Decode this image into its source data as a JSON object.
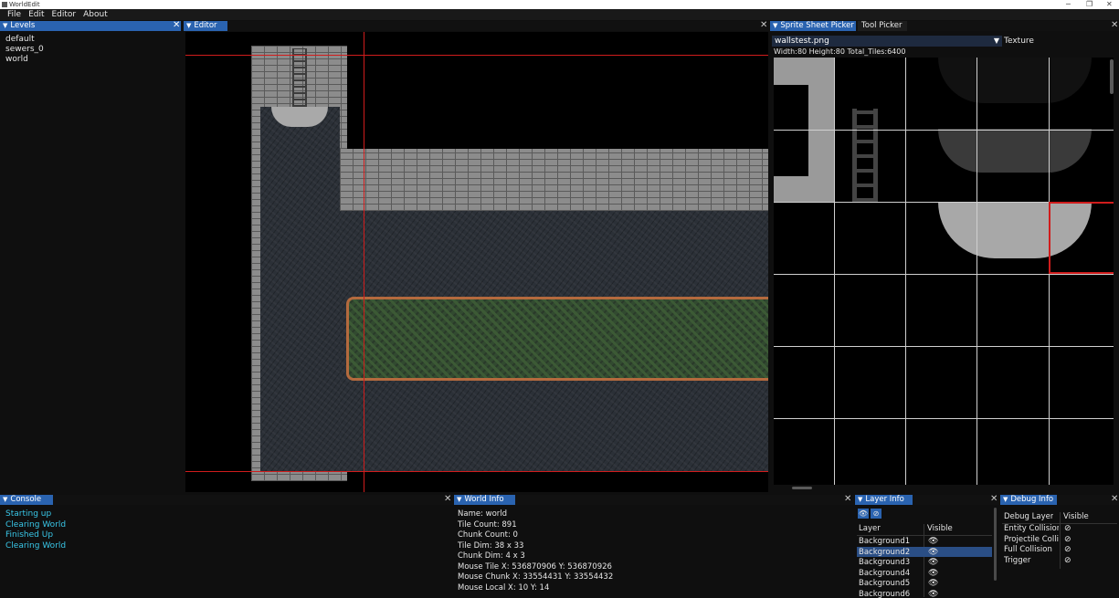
{
  "window": {
    "title": "WorldEdit",
    "minimize": "─",
    "restore": "❐",
    "close": "✕"
  },
  "menu": [
    "File",
    "Edit",
    "Editor",
    "About"
  ],
  "levels": {
    "tab": "Levels",
    "items": [
      "default",
      "sewers_0",
      "world"
    ]
  },
  "editor": {
    "tab": "Editor"
  },
  "sprite_picker": {
    "tab": "Sprite Sheet Picker",
    "tab2": "Tool Picker",
    "texture_value": "wallstest.png",
    "texture_label": "Texture",
    "stats": "Width:80  Height:80  Total_Tiles:6400"
  },
  "console": {
    "tab": "Console",
    "lines": [
      "Starting up",
      "Clearing World",
      "Finished Up",
      "Clearing World"
    ]
  },
  "world_info": {
    "tab": "World Info",
    "lines": [
      "Name:  world",
      "Tile Count: 891",
      "Chunk Count: 0",
      "Tile Dim: 38 x 33",
      "Chunk Dim: 4 x 3",
      "Mouse Tile X: 536870906 Y: 536870926",
      "Mouse Chunk X: 33554431 Y: 33554432",
      "Mouse Local X: 10 Y: 14"
    ]
  },
  "layer_info": {
    "tab": "Layer Info",
    "col_layer": "Layer",
    "col_visible": "Visible",
    "rows": [
      "Background1",
      "Background2",
      "Background3",
      "Background4",
      "Background5",
      "Background6"
    ],
    "selected_index": 1
  },
  "debug_info": {
    "tab": "Debug Info",
    "col_layer": "Debug Layer",
    "col_visible": "Visible",
    "rows": [
      "Entity Collision",
      "Projectile Collisio",
      "Full Collision",
      "Trigger"
    ]
  },
  "icons": {
    "eye": "eye-icon",
    "eye_off": "eye-slash-icon",
    "collapse": "triangle-down-icon",
    "close": "close-icon"
  },
  "colors": {
    "accent": "#2a63b0",
    "console_text": "#39c7e8",
    "boundary": "#d01c1c"
  }
}
